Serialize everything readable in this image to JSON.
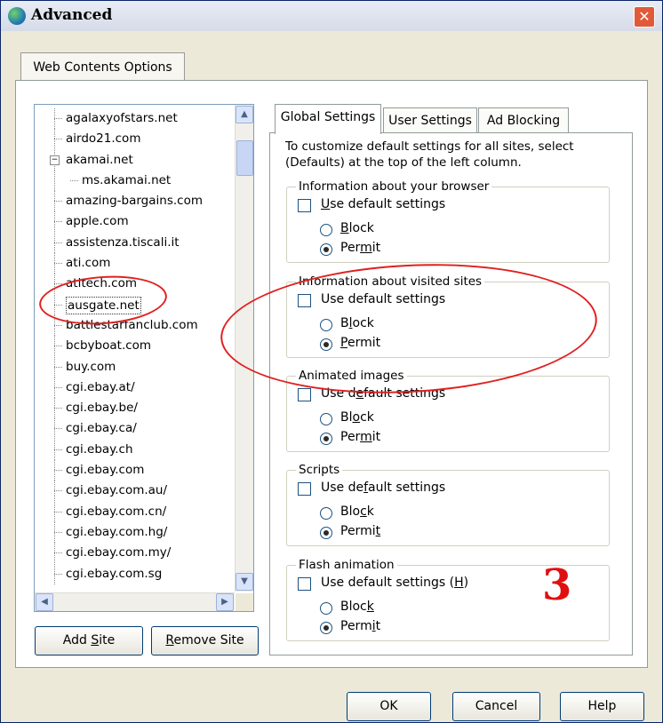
{
  "window": {
    "title": "Advanced",
    "close_label": "✕"
  },
  "outer_tab": {
    "label": "Web Contents Options"
  },
  "tree": {
    "items": [
      {
        "label": "agalaxyofstars.net"
      },
      {
        "label": "airdo21.com"
      },
      {
        "label": "akamai.net",
        "expander": "−"
      },
      {
        "label": "ms.akamai.net"
      },
      {
        "label": "amazing-bargains.com"
      },
      {
        "label": "apple.com"
      },
      {
        "label": "assistenza.tiscali.it"
      },
      {
        "label": "ati.com"
      },
      {
        "label": "atitech.com"
      },
      {
        "label": "ausgate.net"
      },
      {
        "label": "battlestarfanclub.com"
      },
      {
        "label": "bcbyboat.com"
      },
      {
        "label": "buy.com"
      },
      {
        "label": "cgi.ebay.at/"
      },
      {
        "label": "cgi.ebay.be/"
      },
      {
        "label": "cgi.ebay.ca/"
      },
      {
        "label": "cgi.ebay.ch"
      },
      {
        "label": "cgi.ebay.com"
      },
      {
        "label": "cgi.ebay.com.au/"
      },
      {
        "label": "cgi.ebay.com.cn/"
      },
      {
        "label": "cgi.ebay.com.hg/"
      },
      {
        "label": "cgi.ebay.com.my/"
      },
      {
        "label": "cgi.ebay.com.sg"
      }
    ],
    "selected": "ausgate.net",
    "scroll_up": "▲",
    "scroll_down": "▼",
    "scroll_left": "◀",
    "scroll_right": "▶"
  },
  "buttons": {
    "add_site": {
      "pre": "Add ",
      "u": "S",
      "post": "ite"
    },
    "remove_site": {
      "pre": "",
      "u": "R",
      "post": "emove Site"
    },
    "ok": "OK",
    "cancel": "Cancel",
    "help": "Help"
  },
  "inner_tabs": [
    "Global Settings",
    "User Settings",
    "Ad Blocking"
  ],
  "intro_text": "To customize default settings for all sites, select (Defaults) at the top of the left column.",
  "groups": {
    "browser": {
      "title": "Information about your browser",
      "use_default": {
        "u": "U",
        "rest": "se default settings"
      },
      "block": {
        "u": "B",
        "rest": "lock"
      },
      "permit": {
        "pre": "Per",
        "u": "m",
        "post": "it"
      }
    },
    "visited": {
      "title": "Information about visited sites",
      "use_default": {
        "pre": "Use default settings"
      },
      "block": {
        "pre": "B",
        "u": "l",
        "post": "ock"
      },
      "permit": {
        "pre": "",
        "u": "P",
        "post": "ermit"
      }
    },
    "animated": {
      "title": "Animated images",
      "use_default": {
        "pre": "Use d",
        "u": "e",
        "post": "fault settings"
      },
      "block": {
        "pre": "Bl",
        "u": "o",
        "post": "ck"
      },
      "permit": {
        "pre": "Per",
        "u": "m",
        "post": "it"
      }
    },
    "scripts": {
      "title": "Scripts",
      "use_default": {
        "pre": "Use de",
        "u": "f",
        "post": "ault settings"
      },
      "block": {
        "pre": "Blo",
        "u": "c",
        "post": "k"
      },
      "permit": {
        "pre": "Permi",
        "u": "t",
        "post": ""
      }
    },
    "flash": {
      "title": "Flash animation",
      "use_default": {
        "pre": "Use default settings (",
        "u": "H",
        "post": ")"
      },
      "block": {
        "pre": "Bloc",
        "u": "k",
        "post": ""
      },
      "permit": {
        "pre": "Perm",
        "u": "i",
        "post": "t"
      }
    }
  },
  "annotation": {
    "number": "3",
    "color": "#e02020"
  }
}
